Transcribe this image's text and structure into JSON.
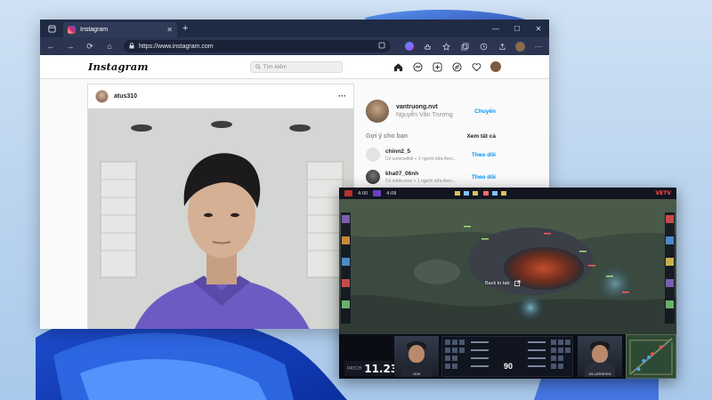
{
  "browser": {
    "tab_title": "Instagram",
    "url": "https://www.instagram.com",
    "icons": [
      "tab-actions-icon",
      "instagram-favicon",
      "close-tab-icon",
      "new-tab-icon",
      "minimize-icon",
      "maximize-icon",
      "close-icon",
      "back-icon",
      "forward-icon",
      "refresh-icon",
      "home-icon",
      "lock-icon",
      "extension-icon",
      "copilot-icon",
      "favorites-icon",
      "collections-icon",
      "history-icon",
      "profile-icon",
      "more-icon"
    ],
    "glyphs": {
      "plus": "+",
      "minimize": "—",
      "maximize": "☐",
      "close": "✕",
      "back": "←",
      "forward": "→",
      "refresh": "⟳",
      "home": "⌂",
      "lock": "🔒",
      "more": "···"
    }
  },
  "instagram": {
    "logo": "Instagram",
    "search_placeholder": "Tìm kiếm",
    "post": {
      "username": "atus310",
      "more": "···"
    },
    "profile": {
      "username": "vantruong.nvt",
      "full_name": "Nguyễn Văn Trương",
      "switch_label": "Chuyển"
    },
    "suggestions": {
      "title": "Gợi ý cho bạn",
      "see_all": "Xem tất cả",
      "items": [
        {
          "username": "chinn2_5",
          "detail": "Có cuneceiloli + 1 người nữa theo...",
          "action": "Theo dõi"
        },
        {
          "username": "kha07_06nh",
          "detail": "Có mkilv.xxxx + 1 người nữa theo...",
          "action": "Theo dõi"
        }
      ]
    }
  },
  "game": {
    "back_to_tab": "Back to tab",
    "patch_label": "PATCH",
    "patch_number": "11.23",
    "player_left": "LEW",
    "player_right": "KILLERSKEN",
    "brand": "VETV",
    "score_center": "90",
    "top_left_gold": "4:00",
    "top_left_gold_2": "4:08"
  },
  "colors": {
    "browser_tabbar": "#1f2a44",
    "browser_toolbar": "#2b3552",
    "instagram_blue": "#0095f6",
    "shirt_purple": "#6d5bc3"
  }
}
